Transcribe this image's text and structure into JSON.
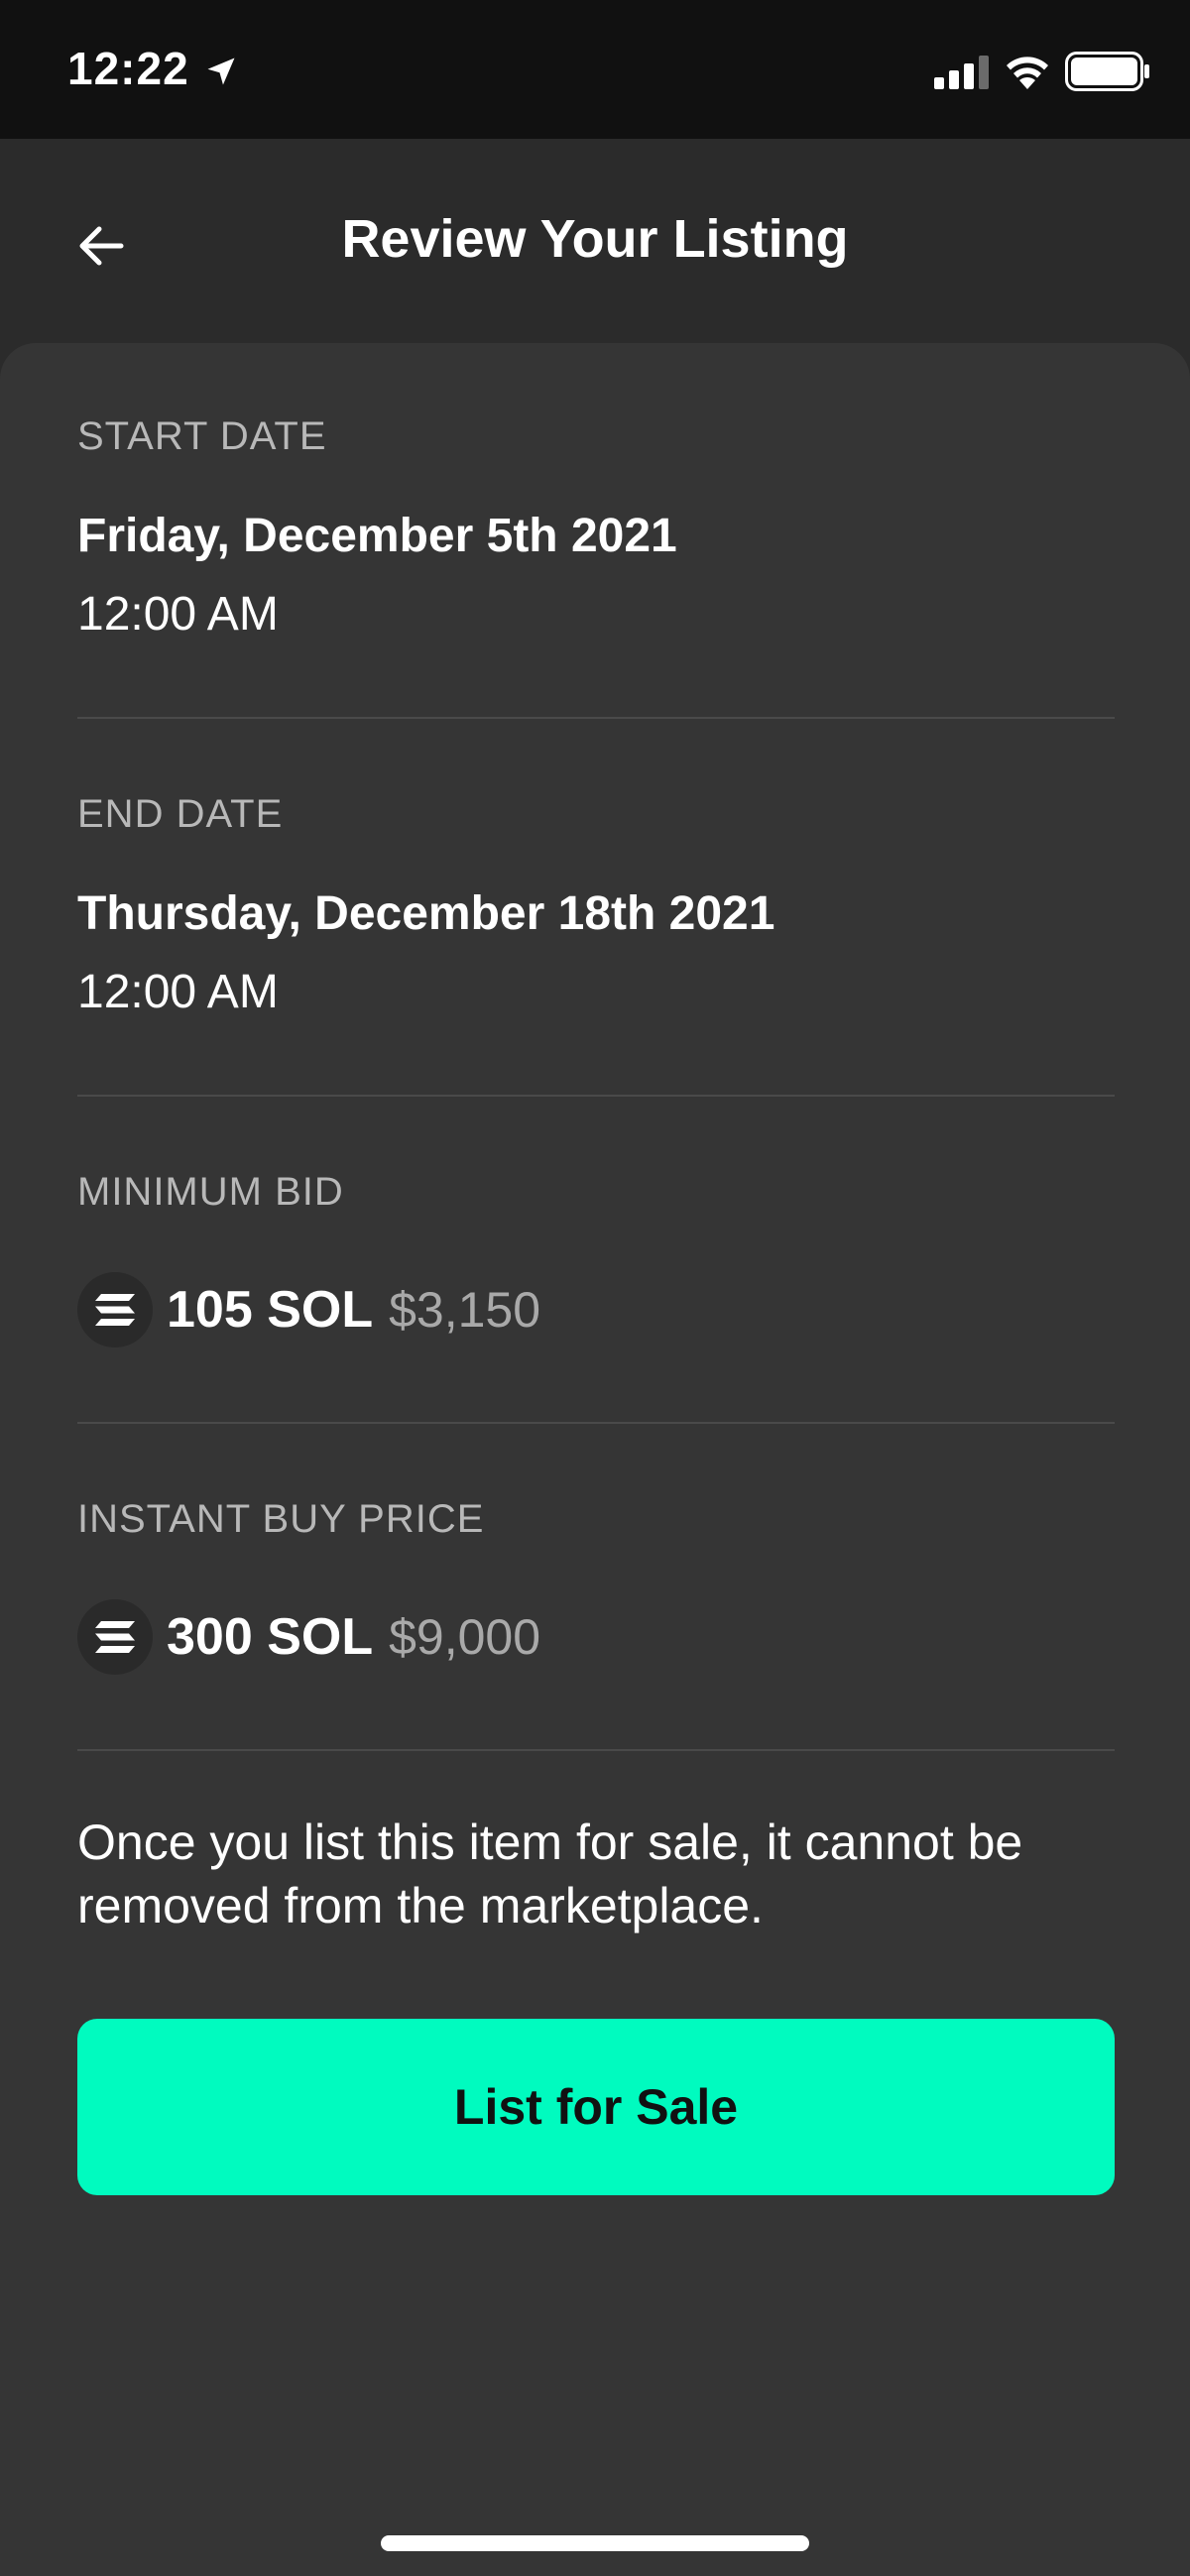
{
  "status_bar": {
    "time": "12:22"
  },
  "header": {
    "title": "Review Your Listing"
  },
  "start": {
    "label": "START DATE",
    "date": "Friday, December 5th 2021",
    "time": "12:00 AM"
  },
  "end": {
    "label": "END DATE",
    "date": "Thursday, December 18th 2021",
    "time": "12:00 AM"
  },
  "minimum_bid": {
    "label": "MINIMUM BID",
    "sol": "105 SOL",
    "usd": "$3,150"
  },
  "instant_buy": {
    "label": "INSTANT BUY PRICE",
    "sol": "300 SOL",
    "usd": "$9,000"
  },
  "disclaimer": "Once you list this item for sale, it cannot be removed from the marketplace.",
  "cta": {
    "label": "List for Sale"
  },
  "colors": {
    "accent": "#00fbbf",
    "background": "#2b2b2b",
    "sheet": "#353535"
  },
  "icons": [
    "location-arrow-icon",
    "signal-icon",
    "wifi-icon",
    "battery-icon",
    "back-arrow-icon",
    "solana-icon"
  ]
}
